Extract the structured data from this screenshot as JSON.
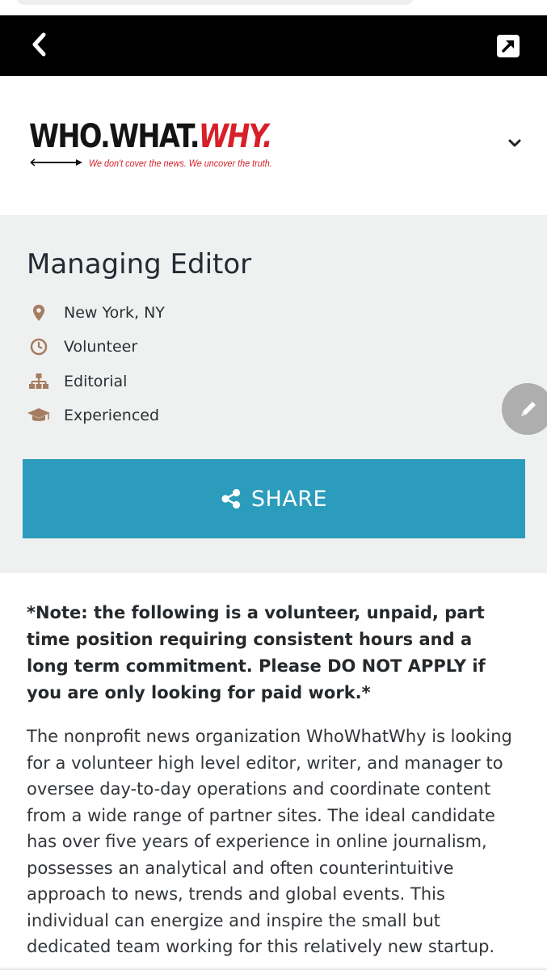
{
  "browser": {
    "back_icon": "chevron-left-icon",
    "external_icon": "external-link-icon",
    "colors": {
      "bar": "#000000"
    }
  },
  "brand": {
    "logo_black": "WHO.WHAT.",
    "logo_red": "WHY.",
    "tagline": "We don't cover the news. We uncover the truth.",
    "colors": {
      "red": "#d7202a",
      "black": "#141414"
    }
  },
  "job": {
    "title": "Managing Editor",
    "meta": [
      {
        "icon": "location-pin-icon",
        "text": "New York, NY"
      },
      {
        "icon": "clock-icon",
        "text": "Volunteer"
      },
      {
        "icon": "org-chart-icon",
        "text": "Editorial"
      },
      {
        "icon": "graduation-cap-icon",
        "text": "Experienced"
      }
    ],
    "share_label": "SHARE",
    "colors": {
      "icon": "#a47c5f",
      "share_bg": "#2b9cbb",
      "panel_bg": "#eff0f0"
    }
  },
  "content": {
    "note": "*Note: the following is a volunteer, unpaid, part time position requiring consistent hours and a long term commitment. Please DO NOT APPLY if you are only looking for paid work.*",
    "description": "The nonprofit news organization WhoWhatWhy is looking for a volunteer high level editor, writer, and manager to oversee day-to-day operations and coordinate content from a wide range of partner sites. The ideal candidate has over five years of experience in online journalism, possesses an analytical and often counterintuitive approach to news, trends and global events. This individual can energize and inspire the small but dedicated team working for this relatively new startup."
  }
}
